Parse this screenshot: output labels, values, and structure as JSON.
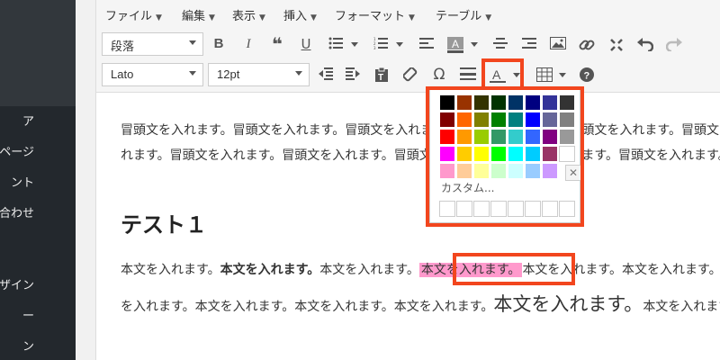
{
  "sidebar": {
    "items": [
      "ア",
      "ページ",
      "ント",
      "お問い合わせ",
      "ザイン",
      "ー",
      "ン"
    ]
  },
  "menubar": {
    "items": [
      "ファイル",
      "編集",
      "表示",
      "挿入",
      "フォーマット",
      "テーブル"
    ]
  },
  "toolbar": {
    "format_select": "段落",
    "font_select": "Lato",
    "size_select": "12pt",
    "omega": "Ω",
    "help": "?"
  },
  "content": {
    "intro_line1": "冒頭文を入れます。冒頭文を入れます。冒頭文を入れます。冒頭文を入れます。冒頭文を入れます。冒頭文を入",
    "intro_line2": "れます。冒頭文を入れます。冒頭文を入れます。冒頭文を入れます。冒頭文を入れます。冒頭文を入れます。",
    "heading": "テスト１",
    "body_line1_a": "本文を入れます。",
    "body_line1_bold": "本文を入れます。",
    "body_line1_b": "本文を入れます。",
    "body_line1_highlight": "本文を入れます。",
    "body_line1_c": "本文を入れます。本文を入れます。",
    "body_line2_a": "を入れます。本文を入れます。本文を入れます。本文を入れます。",
    "body_line2_large": "本文を入れます。",
    "body_line2_b": "本文を入れます。本"
  },
  "picker": {
    "custom_label": "カスタム...",
    "colors": [
      [
        "#000000",
        "#993300",
        "#333300",
        "#003300",
        "#003366",
        "#000080",
        "#333399",
        "#333333"
      ],
      [
        "#800000",
        "#ff6600",
        "#808000",
        "#008000",
        "#008080",
        "#0000ff",
        "#666699",
        "#808080"
      ],
      [
        "#ff0000",
        "#ff9900",
        "#99cc00",
        "#339966",
        "#33cccc",
        "#3366ff",
        "#800080",
        "#999999"
      ],
      [
        "#ff00ff",
        "#ffcc00",
        "#ffff00",
        "#00ff00",
        "#00ffff",
        "#00ccff",
        "#993366",
        "#ffffff"
      ],
      [
        "#ff99cc",
        "#ffcc99",
        "#ffff99",
        "#ccffcc",
        "#ccffff",
        "#99ccff",
        "#cc99ff"
      ]
    ],
    "highlight_color": "#ff99cc",
    "accent_color": "#f2461e"
  }
}
